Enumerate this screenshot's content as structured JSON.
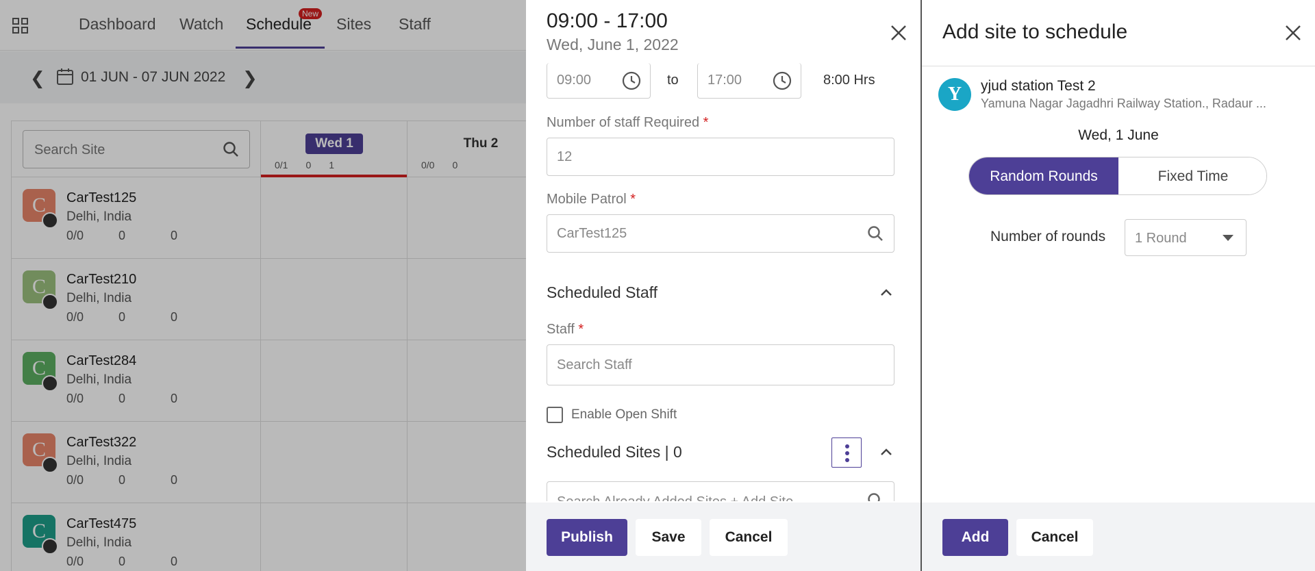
{
  "nav": {
    "items": [
      {
        "label": "Dashboard"
      },
      {
        "label": "Watch"
      },
      {
        "label": "Schedule"
      },
      {
        "label": "Sites"
      },
      {
        "label": "Staff"
      }
    ],
    "new_badge": "New",
    "active": "Schedule"
  },
  "datebar": {
    "range": "01 JUN - 07 JUN 2022"
  },
  "grid": {
    "search_placeholder": "Search Site",
    "days": [
      {
        "label": "Wed 1",
        "selected": true,
        "staff": "0/1",
        "clock": "0",
        "cal": "1"
      },
      {
        "label": "Thu 2",
        "selected": false,
        "staff": "0/0",
        "clock": "0",
        "cal": ""
      }
    ],
    "sites": [
      {
        "initial": "C",
        "name": "CarTest125",
        "location": "Delhi, India",
        "staff": "0/0",
        "clock": "0",
        "cal": "0",
        "color": "#e8866a"
      },
      {
        "initial": "C",
        "name": "CarTest210",
        "location": "Delhi, India",
        "staff": "0/0",
        "clock": "0",
        "cal": "0",
        "color": "#9cc07e"
      },
      {
        "initial": "C",
        "name": "CarTest284",
        "location": "Delhi, India",
        "staff": "0/0",
        "clock": "0",
        "cal": "0",
        "color": "#5cae62"
      },
      {
        "initial": "C",
        "name": "CarTest322",
        "location": "Delhi, India",
        "staff": "0/0",
        "clock": "0",
        "cal": "0",
        "color": "#e8866a"
      },
      {
        "initial": "C",
        "name": "CarTest475",
        "location": "Delhi, India",
        "staff": "0/0",
        "clock": "0",
        "cal": "0",
        "color": "#1e9e8a"
      }
    ]
  },
  "shift": {
    "time_title": "09:00 - 17:00",
    "date_sub": "Wed, June 1, 2022",
    "start_time": "09:00",
    "to_label": "to",
    "end_time": "17:00",
    "hours": "8:00 Hrs",
    "staff_required_label": "Number of staff Required",
    "staff_required_value": "12",
    "mobile_patrol_label": "Mobile Patrol",
    "mobile_patrol_value": "CarTest125",
    "scheduled_staff_title": "Scheduled Staff",
    "staff_label": "Staff",
    "staff_placeholder": "Search Staff",
    "open_shift_label": "Enable Open Shift",
    "scheduled_sites_title": "Scheduled Sites | 0",
    "sites_search_placeholder": "Search Already Added Sites + Add Site",
    "required_mark": "*",
    "buttons": {
      "publish": "Publish",
      "save": "Save",
      "cancel": "Cancel"
    }
  },
  "add_site": {
    "title": "Add site to schedule",
    "site_initial": "Y",
    "site_name": "yjud station Test 2",
    "site_address": "Yamuna Nagar Jagadhri Railway Station., Radaur ...",
    "day": "Wed, 1 June",
    "mode_options": [
      "Random Rounds",
      "Fixed Time"
    ],
    "selected_mode": "Random Rounds",
    "rounds_label": "Number of rounds",
    "rounds_value": "1 Round",
    "buttons": {
      "add": "Add",
      "cancel": "Cancel"
    }
  },
  "colors": {
    "accent": "#4d3f96",
    "required": "#d32020",
    "site_avatar": "#1aa6c6"
  }
}
